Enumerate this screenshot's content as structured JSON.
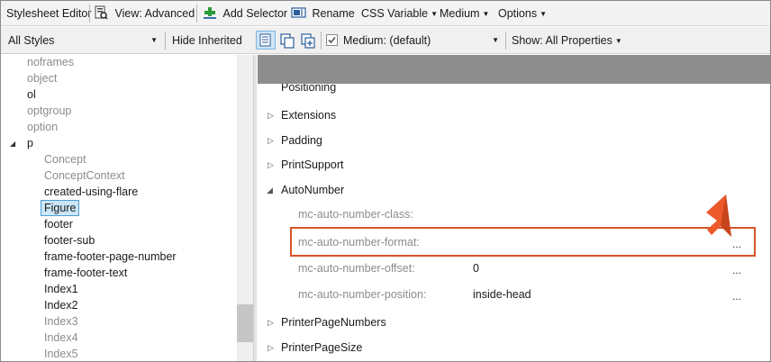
{
  "toolbar": {
    "title": "Stylesheet Editor",
    "view": "View: Advanced",
    "add_selector": "Add Selector",
    "rename": "Rename",
    "css_variable": "CSS Variable",
    "medium": "Medium",
    "options": "Options"
  },
  "toolbar2": {
    "styles_filter": "All Styles",
    "hide_inherited": "Hide Inherited",
    "medium_select": "Medium: (default)",
    "show_properties": "Show: All Properties"
  },
  "tree": {
    "items": [
      "noframes",
      "object",
      "ol",
      "optgroup",
      "option",
      "p",
      "Concept",
      "ConceptContext",
      "created-using-flare",
      "Figure",
      "footer",
      "footer-sub",
      "frame-footer-page-number",
      "frame-footer-text",
      "Index1",
      "Index2",
      "Index3",
      "Index4",
      "Index5"
    ]
  },
  "properties": {
    "partial_group": "Positioning",
    "groups": [
      "Extensions",
      "Padding",
      "PrintSupport",
      "AutoNumber",
      "PrinterPageNumbers",
      "PrinterPageSize"
    ],
    "autonumber": {
      "class_name": "mc-auto-number-class:",
      "format_name": "mc-auto-number-format:",
      "offset_name": "mc-auto-number-offset:",
      "offset_value": "0",
      "position_name": "mc-auto-number-position:",
      "position_value": "inside-head"
    },
    "ellipsis": "..."
  },
  "colors": {
    "highlight_border": "#d9532b",
    "arrow": "#ec5a2c",
    "selection_fill": "#cce6f8",
    "selection_border": "#4a9fd8"
  }
}
